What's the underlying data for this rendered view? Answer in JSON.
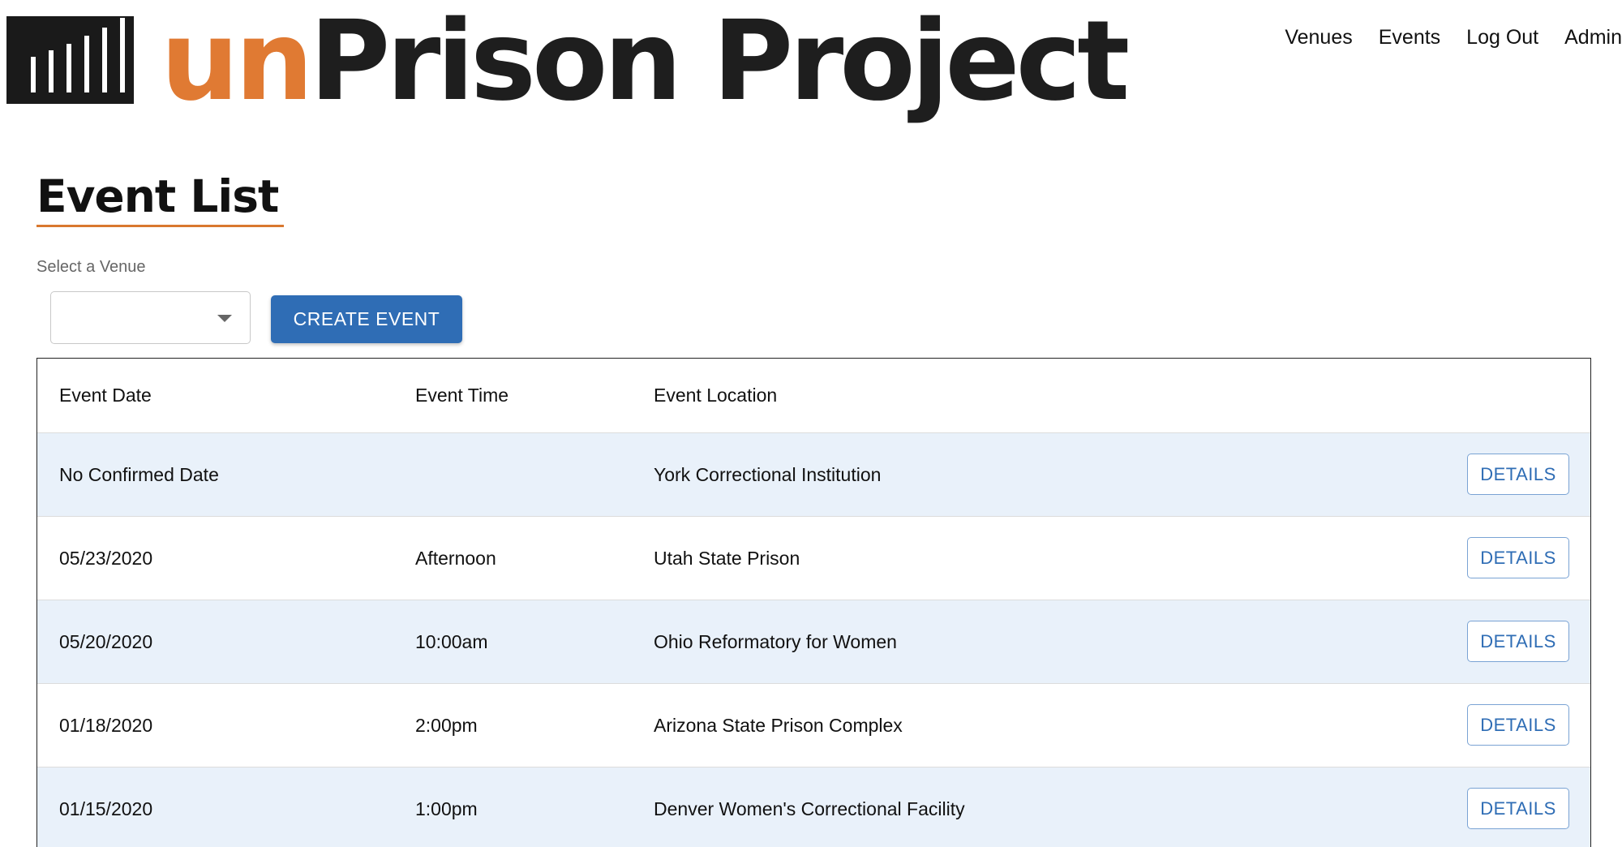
{
  "brand": {
    "prefix": "un",
    "name": "Prison Project",
    "colors": {
      "prefix": "#e07a33",
      "name": "#1e1e1e",
      "mark": "#1a1a1a"
    },
    "icon": "prison-bars-logo-icon"
  },
  "nav": {
    "items": [
      "Venues",
      "Events",
      "Log Out",
      "Admin"
    ]
  },
  "page": {
    "title": "Event List",
    "accent_color": "#d9782f"
  },
  "venue_filter": {
    "label": "Select a Venue",
    "selected": ""
  },
  "actions": {
    "create_event": "CREATE EVENT",
    "primary_color": "#2f6db5"
  },
  "table": {
    "columns": [
      "Event Date",
      "Event Time",
      "Event Location"
    ],
    "row_shade_color": "#e9f1fa",
    "rows": [
      {
        "date": "No Confirmed Date",
        "time": "",
        "location": "York Correctional Institution",
        "action": "DETAILS"
      },
      {
        "date": "05/23/2020",
        "time": "Afternoon",
        "location": "Utah State Prison",
        "action": "DETAILS"
      },
      {
        "date": "05/20/2020",
        "time": "10:00am",
        "location": "Ohio Reformatory for Women",
        "action": "DETAILS"
      },
      {
        "date": "01/18/2020",
        "time": "2:00pm",
        "location": "Arizona State Prison Complex",
        "action": "DETAILS"
      },
      {
        "date": "01/15/2020",
        "time": "1:00pm",
        "location": "Denver Women's Correctional Facility",
        "action": "DETAILS"
      }
    ]
  }
}
